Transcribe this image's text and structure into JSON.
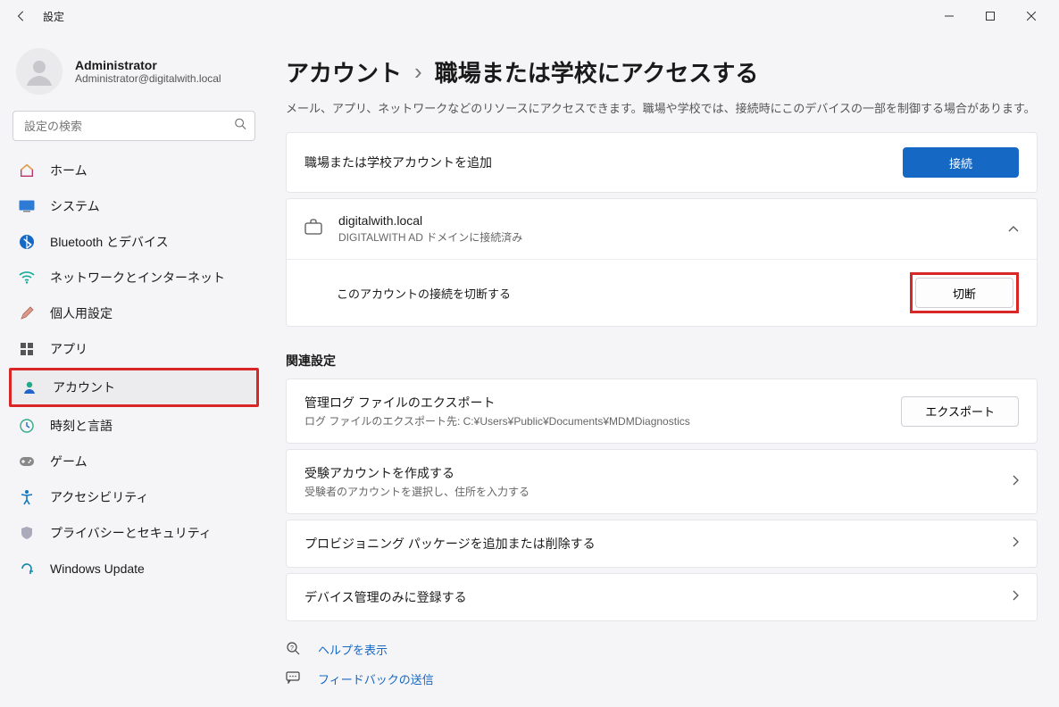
{
  "window": {
    "title": "設定"
  },
  "profile": {
    "name": "Administrator",
    "email": "Administrator@digitalwith.local"
  },
  "search": {
    "placeholder": "設定の検索"
  },
  "nav": [
    {
      "label": "ホーム",
      "key": "home"
    },
    {
      "label": "システム",
      "key": "system"
    },
    {
      "label": "Bluetooth とデバイス",
      "key": "bluetooth"
    },
    {
      "label": "ネットワークとインターネット",
      "key": "network"
    },
    {
      "label": "個人用設定",
      "key": "personalization"
    },
    {
      "label": "アプリ",
      "key": "apps"
    },
    {
      "label": "アカウント",
      "key": "accounts"
    },
    {
      "label": "時刻と言語",
      "key": "time"
    },
    {
      "label": "ゲーム",
      "key": "gaming"
    },
    {
      "label": "アクセシビリティ",
      "key": "accessibility"
    },
    {
      "label": "プライバシーとセキュリティ",
      "key": "privacy"
    },
    {
      "label": "Windows Update",
      "key": "update"
    }
  ],
  "breadcrumb": {
    "parent": "アカウント",
    "current": "職場または学校にアクセスする"
  },
  "subtitle": "メール、アプリ、ネットワークなどのリソースにアクセスできます。職場や学校では、接続時にこのデバイスの一部を制御する場合があります。",
  "add_account": {
    "title": "職場または学校アカウントを追加",
    "button": "接続"
  },
  "connected": {
    "name": "digitalwith.local",
    "detail": "DIGITALWITH AD ドメインに接続済み",
    "disconnect_desc": "このアカウントの接続を切断する",
    "disconnect_btn": "切断"
  },
  "related_heading": "関連設定",
  "related": [
    {
      "title": "管理ログ ファイルのエクスポート",
      "sub": "ログ ファイルのエクスポート先: C:¥Users¥Public¥Documents¥MDMDiagnostics",
      "button": "エクスポート",
      "chevron": false
    },
    {
      "title": "受験アカウントを作成する",
      "sub": "受験者のアカウントを選択し、住所を入力する",
      "button": "",
      "chevron": true
    },
    {
      "title": "プロビジョニング パッケージを追加または削除する",
      "sub": "",
      "button": "",
      "chevron": true
    },
    {
      "title": "デバイス管理のみに登録する",
      "sub": "",
      "button": "",
      "chevron": true
    }
  ],
  "links": {
    "help": "ヘルプを表示",
    "feedback": "フィードバックの送信"
  }
}
